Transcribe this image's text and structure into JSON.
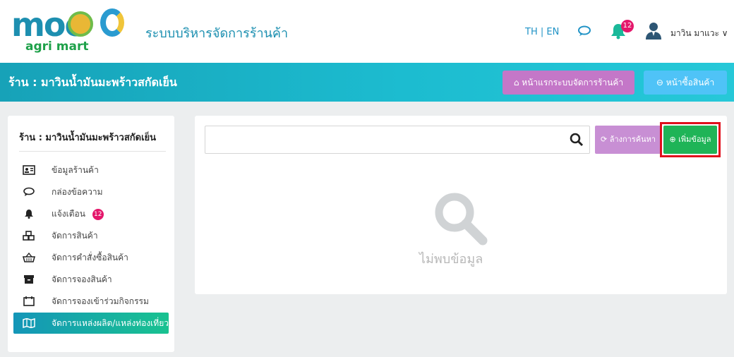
{
  "header": {
    "logo_main": "moc",
    "logo_sub": "agri mart",
    "app_title": "ระบบบริหารจัดการร้านค้า",
    "lang": "TH | EN",
    "notif_count": "12",
    "username": "มาวิน มาแวะ ∨"
  },
  "shopbar": {
    "title": "ร้าน : มาวินน้ำมันมะพร้าวสกัดเย็น",
    "home_button": "หน้าแรกระบบจัดการร้านค้า",
    "buy_button": "หน้าซื้อสินค้า"
  },
  "sidebar": {
    "title": "ร้าน : มาวินน้ำมันมะพร้าวสกัดเย็น",
    "items": [
      {
        "label": "ข้อมูลร้านค้า",
        "icon": "id-card-icon"
      },
      {
        "label": "กล่องข้อความ",
        "icon": "chat-icon"
      },
      {
        "label": "แจ้งเตือน",
        "icon": "bell-icon",
        "badge": "12"
      },
      {
        "label": "จัดการสินค้า",
        "icon": "cubes-icon"
      },
      {
        "label": "จัดการคำสั่งซื้อสินค้า",
        "icon": "basket-icon"
      },
      {
        "label": "จัดการจองสินค้า",
        "icon": "archive-icon"
      },
      {
        "label": "จัดการจองเข้าร่วมกิจกรรม",
        "icon": "calendar-icon"
      },
      {
        "label": "จัดการแหล่งผลิต/แหล่งท่องเที่ยว",
        "icon": "map-icon",
        "active": true
      }
    ]
  },
  "main": {
    "search_placeholder": "",
    "clear_button": "ล้างการค้นหา",
    "add_button": "เพิ่มข้อมูล",
    "empty_text": "ไม่พบข้อมูล"
  },
  "colors": {
    "teal": "#17a2b8",
    "purple": "#c477c8",
    "green": "#1fb457",
    "pink_badge": "#e4176b",
    "highlight_red": "#e00f1c"
  }
}
